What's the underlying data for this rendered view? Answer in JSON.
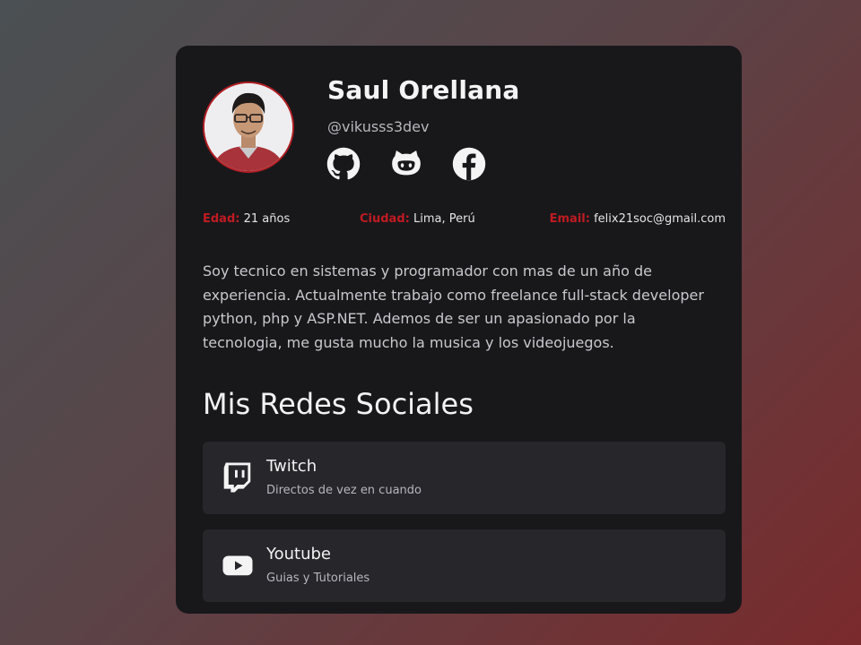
{
  "profile": {
    "name": "Saul Orellana",
    "handle": "@vikusss3dev",
    "social_icons": [
      "github-icon",
      "github-octocat-icon",
      "facebook-icon"
    ]
  },
  "info": {
    "age_label": "Edad:",
    "age_value": "21 años",
    "city_label": "Ciudad:",
    "city_value": "Lima, Perú",
    "email_label": "Email:",
    "email_value": "felix21soc@gmail.com"
  },
  "bio": "Soy tecnico en sistemas y programador con mas de un año de experiencia. Actualmente trabajo como freelance full-stack developer python, php y ASP.NET. Ademos de ser un apasionado por la tecnologia, me gusta mucho la musica y los videojuegos.",
  "social_section": {
    "title": "Mis Redes Sociales",
    "items": [
      {
        "icon": "twitch-icon",
        "title": "Twitch",
        "subtitle": "Directos de vez en cuando"
      },
      {
        "icon": "youtube-icon",
        "title": "Youtube",
        "subtitle": "Guias y Tutoriales"
      }
    ]
  },
  "colors": {
    "card_background": "#18181b",
    "accent": "#c01b22",
    "social_card_background": "#26262b"
  }
}
